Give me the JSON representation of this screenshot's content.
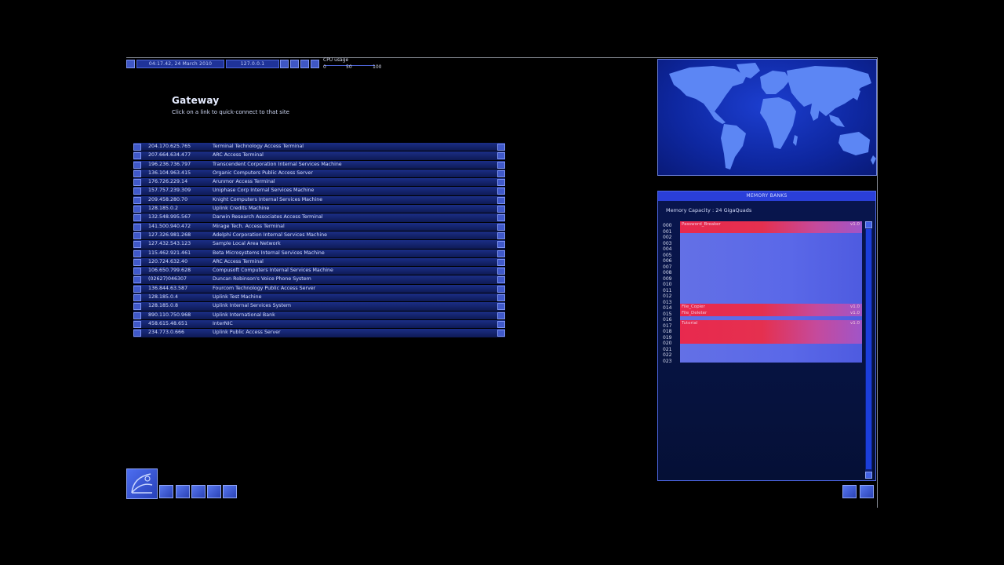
{
  "topbar": {
    "datetime": "04:17.42, 24 March 2010",
    "ip": "127.0.0.1",
    "cpu_label": "CPU usage",
    "cpu_ticks": [
      "0",
      "50",
      "100"
    ]
  },
  "page": {
    "title": "Gateway",
    "subtitle": "Click on a link to quick-connect to that site"
  },
  "links": [
    {
      "ip": "204.170.625.765",
      "name": "Terminal Technology Access Terminal"
    },
    {
      "ip": "207.664.634.477",
      "name": "ARC Access Terminal"
    },
    {
      "ip": "196.236.736.797",
      "name": "Transcendent Corporation Internal Services Machine"
    },
    {
      "ip": "136.104.963.415",
      "name": "Organic Computers Public Access Server"
    },
    {
      "ip": "176.726.229.14",
      "name": "Arunmor Access Terminal"
    },
    {
      "ip": "157.757.239.309",
      "name": "Uniphase Corp Internal Services Machine"
    },
    {
      "ip": "209.458.280.70",
      "name": "Knight Computers Internal Services Machine"
    },
    {
      "ip": "128.185.0.2",
      "name": "Uplink Credits Machine"
    },
    {
      "ip": "132.548.995.567",
      "name": "Darwin Research Associates Access Terminal"
    },
    {
      "ip": "141.500.940.472",
      "name": "Mirage Tech. Access Terminal"
    },
    {
      "ip": "127.326.981.268",
      "name": "Adelphi Corporation Internal Services Machine"
    },
    {
      "ip": "127.432.543.123",
      "name": "Sample Local Area Network"
    },
    {
      "ip": "115.462.921.461",
      "name": "Beta Microsystems Internal Services Machine"
    },
    {
      "ip": "120.724.632.40",
      "name": "ARC Access Terminal"
    },
    {
      "ip": "106.650.799.628",
      "name": "Compusoft Computers Internal Services Machine"
    },
    {
      "ip": "(02627)046307",
      "name": "Duncan Robinson's Voice Phone System"
    },
    {
      "ip": "136.844.63.587",
      "name": "Fourcom Technology Public Access Server"
    },
    {
      "ip": "128.185.0.4",
      "name": "Uplink Test Machine"
    },
    {
      "ip": "128.185.0.8",
      "name": "Uplink Internal Services System"
    },
    {
      "ip": "890.110.750.968",
      "name": "Uplink International Bank"
    },
    {
      "ip": "458.615.48.651",
      "name": "InterNIC"
    },
    {
      "ip": "234.773.0.666",
      "name": "Uplink Public Access Server"
    }
  ],
  "memory": {
    "header": "MEMORY BANKS",
    "capacity": "Memory Capacity : 24 GigaQuads",
    "indices": [
      "000",
      "001",
      "002",
      "003",
      "004",
      "005",
      "006",
      "007",
      "008",
      "009",
      "010",
      "011",
      "012",
      "013",
      "014",
      "015",
      "016",
      "017",
      "018",
      "019",
      "020",
      "021",
      "022",
      "023"
    ],
    "slots": [
      {
        "name": "Password_Breaker",
        "version": "v1.0"
      },
      {
        "name": "File_Copier",
        "version": "v1.0"
      },
      {
        "name": "File_Deleter",
        "version": "v1.0"
      },
      {
        "name": "Tutorial",
        "version": "v1.0"
      }
    ]
  },
  "colors": {
    "accent": "#2a3fd8",
    "program_slot": "#e8294e",
    "memory_free": "#5a68e8",
    "background": "#000000"
  }
}
